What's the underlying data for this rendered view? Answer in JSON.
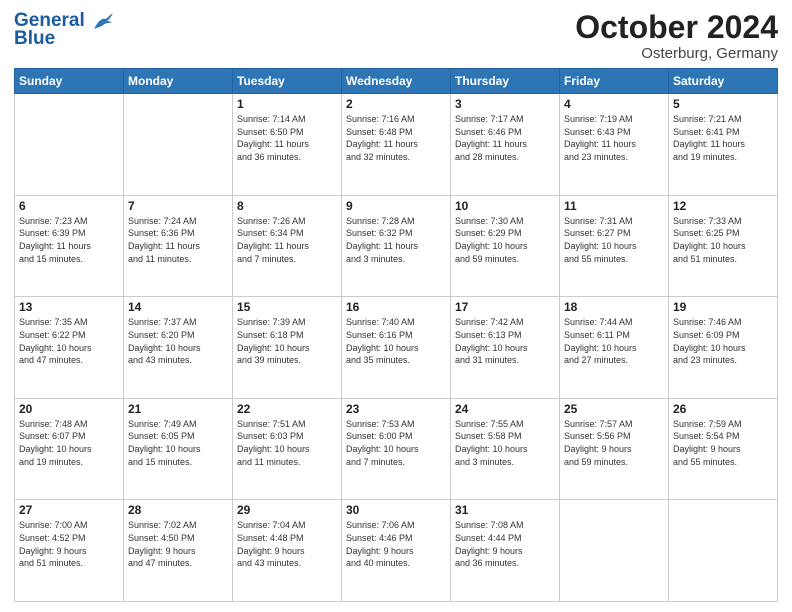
{
  "header": {
    "logo_line1": "General",
    "logo_line2": "Blue",
    "month": "October 2024",
    "location": "Osterburg, Germany"
  },
  "weekdays": [
    "Sunday",
    "Monday",
    "Tuesday",
    "Wednesday",
    "Thursday",
    "Friday",
    "Saturday"
  ],
  "weeks": [
    [
      {
        "day": "",
        "info": ""
      },
      {
        "day": "",
        "info": ""
      },
      {
        "day": "1",
        "info": "Sunrise: 7:14 AM\nSunset: 6:50 PM\nDaylight: 11 hours\nand 36 minutes."
      },
      {
        "day": "2",
        "info": "Sunrise: 7:16 AM\nSunset: 6:48 PM\nDaylight: 11 hours\nand 32 minutes."
      },
      {
        "day": "3",
        "info": "Sunrise: 7:17 AM\nSunset: 6:46 PM\nDaylight: 11 hours\nand 28 minutes."
      },
      {
        "day": "4",
        "info": "Sunrise: 7:19 AM\nSunset: 6:43 PM\nDaylight: 11 hours\nand 23 minutes."
      },
      {
        "day": "5",
        "info": "Sunrise: 7:21 AM\nSunset: 6:41 PM\nDaylight: 11 hours\nand 19 minutes."
      }
    ],
    [
      {
        "day": "6",
        "info": "Sunrise: 7:23 AM\nSunset: 6:39 PM\nDaylight: 11 hours\nand 15 minutes."
      },
      {
        "day": "7",
        "info": "Sunrise: 7:24 AM\nSunset: 6:36 PM\nDaylight: 11 hours\nand 11 minutes."
      },
      {
        "day": "8",
        "info": "Sunrise: 7:26 AM\nSunset: 6:34 PM\nDaylight: 11 hours\nand 7 minutes."
      },
      {
        "day": "9",
        "info": "Sunrise: 7:28 AM\nSunset: 6:32 PM\nDaylight: 11 hours\nand 3 minutes."
      },
      {
        "day": "10",
        "info": "Sunrise: 7:30 AM\nSunset: 6:29 PM\nDaylight: 10 hours\nand 59 minutes."
      },
      {
        "day": "11",
        "info": "Sunrise: 7:31 AM\nSunset: 6:27 PM\nDaylight: 10 hours\nand 55 minutes."
      },
      {
        "day": "12",
        "info": "Sunrise: 7:33 AM\nSunset: 6:25 PM\nDaylight: 10 hours\nand 51 minutes."
      }
    ],
    [
      {
        "day": "13",
        "info": "Sunrise: 7:35 AM\nSunset: 6:22 PM\nDaylight: 10 hours\nand 47 minutes."
      },
      {
        "day": "14",
        "info": "Sunrise: 7:37 AM\nSunset: 6:20 PM\nDaylight: 10 hours\nand 43 minutes."
      },
      {
        "day": "15",
        "info": "Sunrise: 7:39 AM\nSunset: 6:18 PM\nDaylight: 10 hours\nand 39 minutes."
      },
      {
        "day": "16",
        "info": "Sunrise: 7:40 AM\nSunset: 6:16 PM\nDaylight: 10 hours\nand 35 minutes."
      },
      {
        "day": "17",
        "info": "Sunrise: 7:42 AM\nSunset: 6:13 PM\nDaylight: 10 hours\nand 31 minutes."
      },
      {
        "day": "18",
        "info": "Sunrise: 7:44 AM\nSunset: 6:11 PM\nDaylight: 10 hours\nand 27 minutes."
      },
      {
        "day": "19",
        "info": "Sunrise: 7:46 AM\nSunset: 6:09 PM\nDaylight: 10 hours\nand 23 minutes."
      }
    ],
    [
      {
        "day": "20",
        "info": "Sunrise: 7:48 AM\nSunset: 6:07 PM\nDaylight: 10 hours\nand 19 minutes."
      },
      {
        "day": "21",
        "info": "Sunrise: 7:49 AM\nSunset: 6:05 PM\nDaylight: 10 hours\nand 15 minutes."
      },
      {
        "day": "22",
        "info": "Sunrise: 7:51 AM\nSunset: 6:03 PM\nDaylight: 10 hours\nand 11 minutes."
      },
      {
        "day": "23",
        "info": "Sunrise: 7:53 AM\nSunset: 6:00 PM\nDaylight: 10 hours\nand 7 minutes."
      },
      {
        "day": "24",
        "info": "Sunrise: 7:55 AM\nSunset: 5:58 PM\nDaylight: 10 hours\nand 3 minutes."
      },
      {
        "day": "25",
        "info": "Sunrise: 7:57 AM\nSunset: 5:56 PM\nDaylight: 9 hours\nand 59 minutes."
      },
      {
        "day": "26",
        "info": "Sunrise: 7:59 AM\nSunset: 5:54 PM\nDaylight: 9 hours\nand 55 minutes."
      }
    ],
    [
      {
        "day": "27",
        "info": "Sunrise: 7:00 AM\nSunset: 4:52 PM\nDaylight: 9 hours\nand 51 minutes."
      },
      {
        "day": "28",
        "info": "Sunrise: 7:02 AM\nSunset: 4:50 PM\nDaylight: 9 hours\nand 47 minutes."
      },
      {
        "day": "29",
        "info": "Sunrise: 7:04 AM\nSunset: 4:48 PM\nDaylight: 9 hours\nand 43 minutes."
      },
      {
        "day": "30",
        "info": "Sunrise: 7:06 AM\nSunset: 4:46 PM\nDaylight: 9 hours\nand 40 minutes."
      },
      {
        "day": "31",
        "info": "Sunrise: 7:08 AM\nSunset: 4:44 PM\nDaylight: 9 hours\nand 36 minutes."
      },
      {
        "day": "",
        "info": ""
      },
      {
        "day": "",
        "info": ""
      }
    ]
  ]
}
